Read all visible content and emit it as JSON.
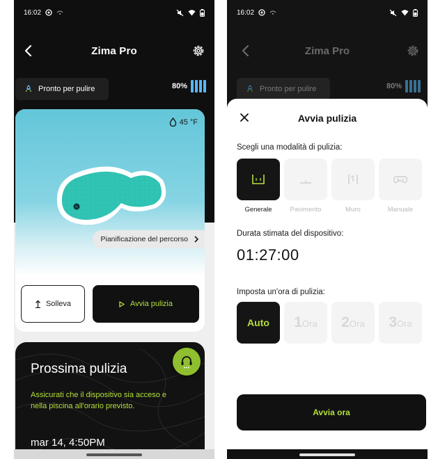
{
  "status_bar": {
    "time": "16:02"
  },
  "screen_main": {
    "title": "Zima Pro",
    "ready_status": "Pronto per pulire",
    "battery": "80%",
    "temperature": "45 °F",
    "path_planning": "Pianificazione del percorso",
    "lift_label": "Solleva",
    "start_label": "Avvia pulizia",
    "next_clean": {
      "title": "Prossima pulizia",
      "description": "Assicurati che il dispositivo sia acceso e nella piscina all'orario previsto.",
      "date": "mar 14, 4:50PM"
    }
  },
  "screen_sheet": {
    "title": "Zima Pro",
    "ready_status": "Pronto per pulire",
    "battery": "80%",
    "sheet_title": "Avvia pulizia",
    "mode_label": "Scegli una modalità di pulizia:",
    "modes": [
      {
        "label": "Generale",
        "icon": "pool-general-icon",
        "selected": true
      },
      {
        "label": "Pavimento",
        "icon": "pool-floor-icon",
        "selected": false
      },
      {
        "label": "Muro",
        "icon": "pool-wall-icon",
        "selected": false
      },
      {
        "label": "Manuale",
        "icon": "gamepad-icon",
        "selected": false
      }
    ],
    "duration_label": "Durata stimata del dispositivo:",
    "duration_value": "01:27:00",
    "time_label": "Imposta un'ora di pulizia:",
    "times": [
      {
        "num": "Auto",
        "unit": "",
        "selected": true
      },
      {
        "num": "1",
        "unit": "Ora",
        "selected": false
      },
      {
        "num": "2",
        "unit": "Ora",
        "selected": false
      },
      {
        "num": "3",
        "unit": "Ora",
        "selected": false
      }
    ],
    "start_now_label": "Avvia ora"
  },
  "colors": {
    "accent_green": "#b6e03c",
    "battery_blue": "#5ab6f5",
    "pool_water": "#63c6d9",
    "dark": "#111111"
  }
}
